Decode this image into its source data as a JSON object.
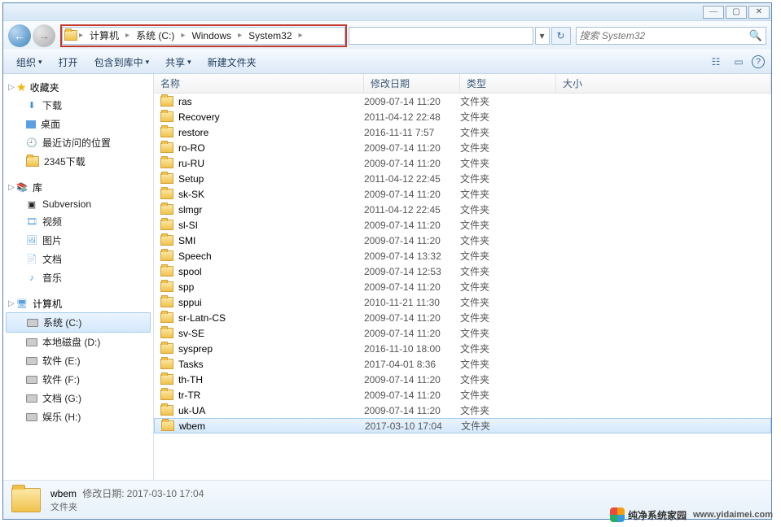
{
  "titlebar": {
    "min": "―",
    "max": "▢",
    "close": "✕"
  },
  "nav": {
    "back": "←",
    "fwd": "→"
  },
  "breadcrumbs": [
    "计算机",
    "系统 (C:)",
    "Windows",
    "System32"
  ],
  "addr_dropdown": "▾",
  "refresh": "↻",
  "search": {
    "placeholder": "搜索 System32",
    "icon": "🔍"
  },
  "toolbar": {
    "items": [
      "组织",
      "打开",
      "包含到库中",
      "共享",
      "新建文件夹"
    ],
    "dd": "▾",
    "view": "☷",
    "preview": "▭",
    "help": "?"
  },
  "sidebar": {
    "favorites": {
      "label": "收藏夹",
      "items": [
        "下载",
        "桌面",
        "最近访问的位置",
        "2345下载"
      ]
    },
    "libraries": {
      "label": "库",
      "items": [
        "Subversion",
        "视频",
        "图片",
        "文档",
        "音乐"
      ]
    },
    "computer": {
      "label": "计算机",
      "items": [
        "系统 (C:)",
        "本地磁盘 (D:)",
        "软件 (E:)",
        "软件 (F:)",
        "文档 (G:)",
        "娱乐 (H:)"
      ],
      "selected": 0
    }
  },
  "columns": [
    "名称",
    "修改日期",
    "类型",
    "大小"
  ],
  "type_folder": "文件夹",
  "files": [
    {
      "n": "ras",
      "d": "2009-07-14 11:20"
    },
    {
      "n": "Recovery",
      "d": "2011-04-12 22:48"
    },
    {
      "n": "restore",
      "d": "2016-11-11 7:57"
    },
    {
      "n": "ro-RO",
      "d": "2009-07-14 11:20"
    },
    {
      "n": "ru-RU",
      "d": "2009-07-14 11:20"
    },
    {
      "n": "Setup",
      "d": "2011-04-12 22:45"
    },
    {
      "n": "sk-SK",
      "d": "2009-07-14 11:20"
    },
    {
      "n": "slmgr",
      "d": "2011-04-12 22:45"
    },
    {
      "n": "sl-SI",
      "d": "2009-07-14 11:20"
    },
    {
      "n": "SMI",
      "d": "2009-07-14 11:20"
    },
    {
      "n": "Speech",
      "d": "2009-07-14 13:32"
    },
    {
      "n": "spool",
      "d": "2009-07-14 12:53"
    },
    {
      "n": "spp",
      "d": "2009-07-14 11:20"
    },
    {
      "n": "sppui",
      "d": "2010-11-21 11:30"
    },
    {
      "n": "sr-Latn-CS",
      "d": "2009-07-14 11:20"
    },
    {
      "n": "sv-SE",
      "d": "2009-07-14 11:20"
    },
    {
      "n": "sysprep",
      "d": "2016-11-10 18:00"
    },
    {
      "n": "Tasks",
      "d": "2017-04-01 8:36"
    },
    {
      "n": "th-TH",
      "d": "2009-07-14 11:20"
    },
    {
      "n": "tr-TR",
      "d": "2009-07-14 11:20"
    },
    {
      "n": "uk-UA",
      "d": "2009-07-14 11:20"
    },
    {
      "n": "wbem",
      "d": "2017-03-10 17:04",
      "sel": true
    }
  ],
  "details": {
    "name": "wbem",
    "label_date": "修改日期:",
    "date": "2017-03-10 17:04",
    "type": "文件夹"
  },
  "watermark": {
    "text": "纯净系统家园",
    "url": "www.yidaimei.com"
  }
}
